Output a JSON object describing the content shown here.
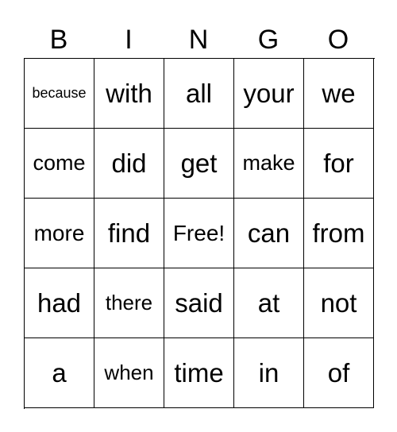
{
  "header": [
    "B",
    "I",
    "N",
    "G",
    "O"
  ],
  "cells": [
    [
      "because",
      "with",
      "all",
      "your",
      "we"
    ],
    [
      "come",
      "did",
      "get",
      "make",
      "for"
    ],
    [
      "more",
      "find",
      "Free!",
      "can",
      "from"
    ],
    [
      "had",
      "there",
      "said",
      "at",
      "not"
    ],
    [
      "a",
      "when",
      "time",
      "in",
      "of"
    ]
  ]
}
